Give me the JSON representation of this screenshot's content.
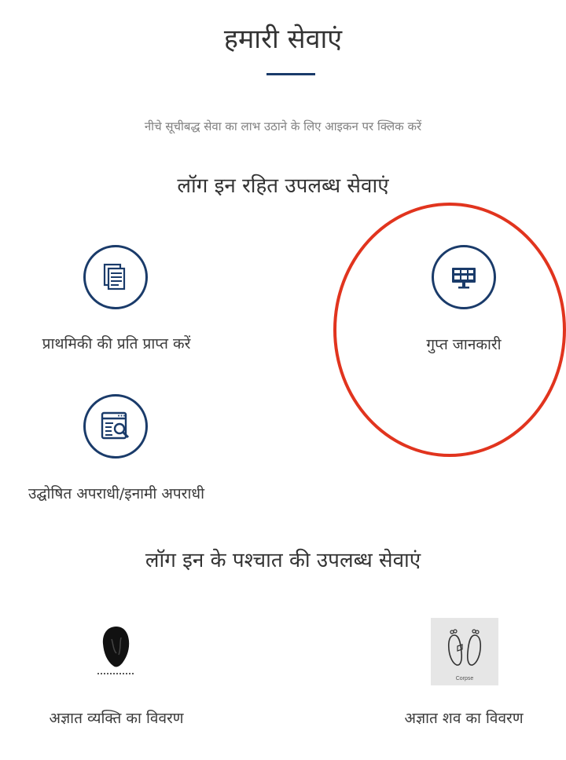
{
  "page": {
    "title": "हमारी सेवाएं",
    "subtitle": "नीचे सूचीबद्ध सेवा का लाभ उठाने के लिए आइकन पर क्लिक करें"
  },
  "sections": [
    {
      "heading": "लॉग इन रहित उपलब्ध सेवाएं",
      "services": [
        {
          "label": "प्राथमिकी की प्रति प्राप्त करें",
          "icon": "document-stack-icon"
        },
        {
          "label": "गुप्त जानकारी",
          "icon": "monitor-icon"
        },
        {
          "label": "उद्घोषित अपराधी/इनामी अपराधी",
          "icon": "document-search-icon"
        }
      ]
    },
    {
      "heading": "लॉग इन के पश्चात की उपलब्ध सेवाएं",
      "services": [
        {
          "label": "अज्ञात व्यक्ति का विवरण",
          "icon": "unknown-person-icon"
        },
        {
          "label": "अज्ञात शव का विवरण",
          "icon": "corpse-feet-icon",
          "caption": "Corpse"
        }
      ]
    }
  ],
  "colors": {
    "accent": "#1a3b6a",
    "highlight": "#e1341e",
    "muted_text": "#808080"
  }
}
